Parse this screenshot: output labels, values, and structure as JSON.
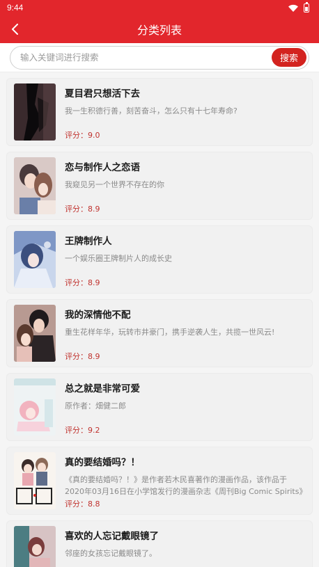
{
  "status_bar": {
    "time": "9:44"
  },
  "header": {
    "title": "分类列表"
  },
  "search": {
    "placeholder": "输入关键词进行搜索",
    "button_label": "搜索"
  },
  "colors": {
    "accent": "#e2262c",
    "rating": "#c0322e"
  },
  "books": [
    {
      "title": "夏目君只想活下去",
      "desc": "我一生积德行善，刻苦奋斗，怎么只有十七年寿命?",
      "rating": "评分：9.0"
    },
    {
      "title": "恋与制作人之恋语",
      "desc": "我窥见另一个世界不存在的你",
      "rating": "评分：8.9"
    },
    {
      "title": "王牌制作人",
      "desc": "一个娱乐圈王牌制片人的成长史",
      "rating": "评分：8.9"
    },
    {
      "title": "我的深情他不配",
      "desc": "重生花样年华，玩转市井豪门，携手逆袭人生，共揽一世风云!",
      "rating": "评分：8.9"
    },
    {
      "title": "总之就是非常可爱",
      "desc": "原作者：畑健二郎",
      "rating": "评分：9.2"
    },
    {
      "title": "真的要结婚吗？！",
      "desc": "《真的要结婚吗？！》是作者若木民喜著作的漫画作品，该作品于2020年03月16日在小学馆发行的漫画杂志《周刊Big Comic Spirits》上连...",
      "rating": "评分：8.8"
    },
    {
      "title": "喜欢的人忘记戴眼镜了",
      "desc": "邻座的女孩忘记戴眼镜了。",
      "rating": ""
    }
  ]
}
